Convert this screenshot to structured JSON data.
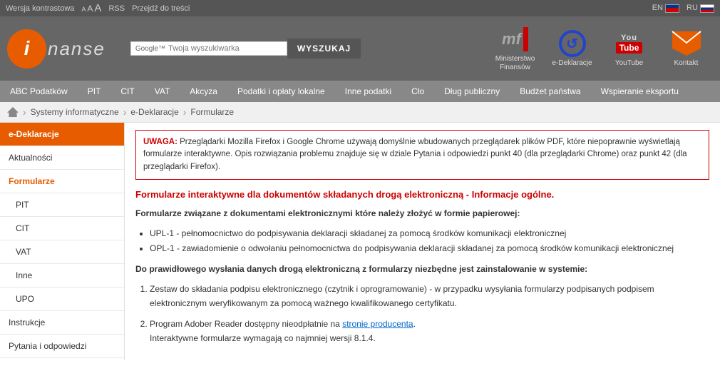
{
  "topbar": {
    "contrast_label": "Wersja kontrastowa",
    "a_label": "A",
    "rss_label": "RSS",
    "skip_label": "Przejdź do treści",
    "lang_en": "EN",
    "lang_ru": "RU"
  },
  "header": {
    "logo_letter": "i",
    "logo_text": "nanse",
    "search_placeholder": "Twoja wyszukiwarka",
    "google_label": "Google™",
    "search_button": "WYSZUKAJ",
    "icons": [
      {
        "label": "Ministerstwo\nFinansów",
        "id": "ministerstwo"
      },
      {
        "label": "e-Deklaracje",
        "id": "edekl"
      },
      {
        "label": "YouTube",
        "id": "youtube"
      },
      {
        "label": "Kontakt",
        "id": "kontakt"
      }
    ]
  },
  "nav": {
    "items": [
      "ABC Podatków",
      "PIT",
      "CIT",
      "VAT",
      "Akcyza",
      "Podatki i opłaty lokalne",
      "Inne podatki",
      "Cło",
      "Dług publiczny",
      "Budżet państwa",
      "Wspieranie eksportu"
    ]
  },
  "breadcrumb": {
    "home": "",
    "items": [
      "Systemy informatyczne",
      "e-Deklaracje",
      "Formularze"
    ]
  },
  "sidebar": {
    "items": [
      {
        "label": "e-Deklaracje",
        "type": "active-section"
      },
      {
        "label": "Aktualności",
        "type": "normal"
      },
      {
        "label": "Formularze",
        "type": "active-link"
      },
      {
        "label": "PIT",
        "type": "sub"
      },
      {
        "label": "CIT",
        "type": "sub"
      },
      {
        "label": "VAT",
        "type": "sub"
      },
      {
        "label": "Inne",
        "type": "sub"
      },
      {
        "label": "UPO",
        "type": "sub"
      },
      {
        "label": "Instrukcje",
        "type": "normal"
      },
      {
        "label": "Pytania i odpowiedzi",
        "type": "normal"
      }
    ]
  },
  "main": {
    "warning_prefix": "UWAGA:",
    "warning_text": " Przeglądarki Mozilla Firefox i Google Chrome używają domyślnie wbudowanych przeglądarek plików PDF, które niepoprawnie wyświetlają formularze interaktywne. Opis rozwiązania problemu znajduje się w dziale Pytania i odpowiedzi punkt 40 (dla przeglądarki Chrome) oraz punkt 42 (dla przeglądarki Firefox).",
    "section_title": "Formularze interaktywne dla dokumentów składanych drogą elektroniczną - Informacje ogólne.",
    "para1_bold": "Formularze związane z dokumentami elektronicznymi które należy złożyć w formie papierowej:",
    "bullets": [
      "UPL-1 - pełnomocnictwo do podpisywania deklaracji składanej za pomocą środków komunikacji elektronicznej",
      "OPL-1 - zawiadomienie o odwołaniu pełnomocnictwa do podpisywania deklaracji składanej za pomocą środków komunikacji elektronicznej"
    ],
    "para2_bold": "Do prawidłowego wysłania danych drogą elektroniczną z formularzy niezbędne jest zainstalowanie w systemie:",
    "numbered": [
      {
        "text": "Zestaw do składania podpisu elektronicznego (czytnik i oprogramowanie) - w przypadku wysyłania formularzy podpisanych podpisem elektronicznym weryfikowanym za pomocą ważnego kwalifikowanego certyfikatu."
      },
      {
        "text_before": "Program Adober Reader dostępny nieodpłatnie na ",
        "link": "stronie producenta",
        "text_after": ".\nInteraktywne formularze wymagają co najmniej wersji 8.1.4."
      }
    ]
  }
}
